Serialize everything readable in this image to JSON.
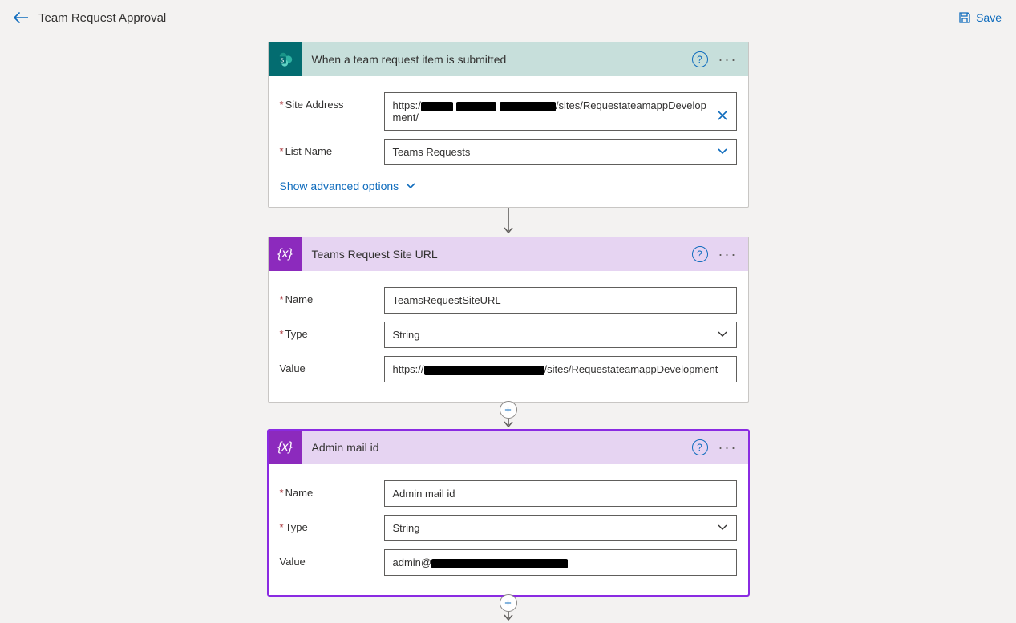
{
  "header": {
    "title": "Team Request Approval",
    "save_label": "Save"
  },
  "card1": {
    "title": "When a team request item is submitted",
    "site_address_label": "Site Address",
    "site_address_prefix": "https:/",
    "site_address_suffix": "/sites/RequestateamappDevelopment/",
    "list_name_label": "List Name",
    "list_name_value": "Teams Requests",
    "advanced_label": "Show advanced options"
  },
  "card2": {
    "title": "Teams Request Site URL",
    "name_label": "Name",
    "name_value": "TeamsRequestSiteURL",
    "type_label": "Type",
    "type_value": "String",
    "value_label": "Value",
    "value_prefix": "https://",
    "value_suffix": "/sites/RequestateamappDevelopment"
  },
  "card3": {
    "title": "Admin mail id",
    "name_label": "Name",
    "name_value": "Admin mail id",
    "type_label": "Type",
    "type_value": "String",
    "value_label": "Value",
    "value_prefix": "admin@"
  },
  "icons": {
    "variable_glyph": "{x}"
  }
}
